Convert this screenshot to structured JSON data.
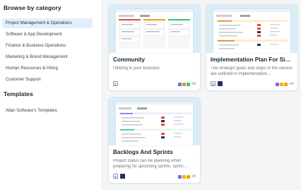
{
  "sidebar": {
    "heading": "Browse by category",
    "items": [
      {
        "label": "Project Management & Operations",
        "active": true
      },
      {
        "label": "Software & App Development"
      },
      {
        "label": "Finance & Business Operations"
      },
      {
        "label": "Marketing & Brand Management"
      },
      {
        "label": "Human Resources & Hiring"
      },
      {
        "label": "Customer Support"
      }
    ],
    "templates_heading": "Templates",
    "templates_item": "Allan Software's Templates"
  },
  "cards": [
    {
      "title": "Community",
      "description": "Utilizing in your business",
      "members_extra": "+5",
      "dot_colors": [
        "#7b68ee",
        "#c9a227",
        "#2ecc71"
      ]
    },
    {
      "title": "Implementation Plan For Simpl...",
      "description": "The strategic goals and steps of the service are outlined in implementation...",
      "members_extra": "+4",
      "dot_colors": [
        "#7b68ee",
        "#f5b400",
        "#f39c12"
      ]
    },
    {
      "title": "Backlogs And Sprints",
      "description": "Project status can be planning when preparing for upcoming sprints, sprint...",
      "members_extra": "+5",
      "dot_colors": [
        "#7b68ee",
        "#f5b400",
        "#f39c12"
      ]
    }
  ],
  "icons": {
    "list_view": "list-view-icon",
    "board_view": "board-view-icon"
  }
}
